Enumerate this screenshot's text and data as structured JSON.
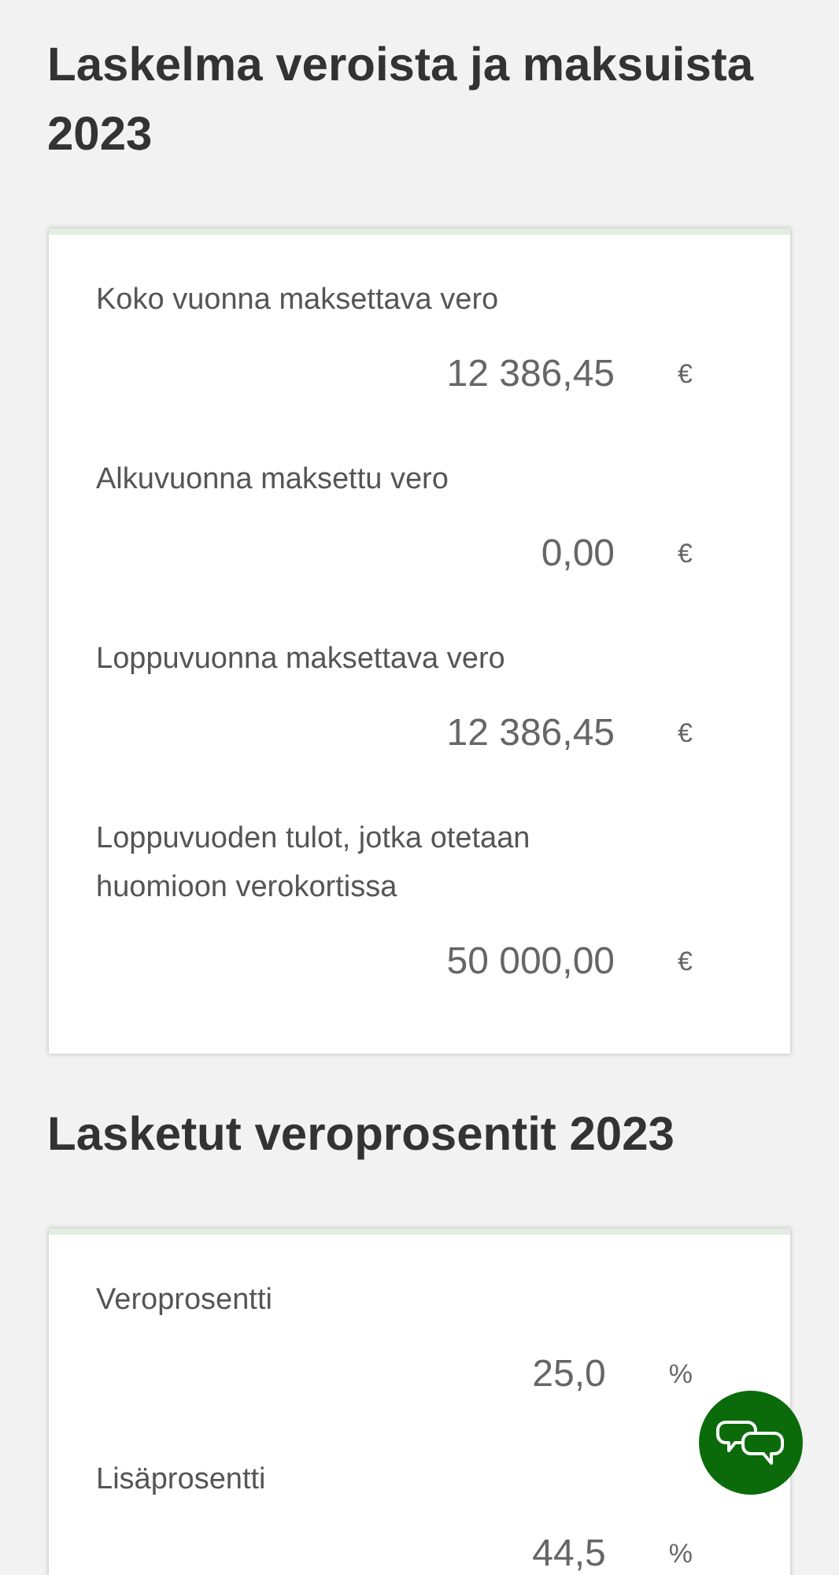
{
  "sections": [
    {
      "title": "Laskelma veroista ja maksuista 2023",
      "rows": [
        {
          "label": "Koko vuonna maksettava vero",
          "value": "12 386,45",
          "unit": "€"
        },
        {
          "label": "Alkuvuonna maksettu vero",
          "value": "0,00",
          "unit": "€"
        },
        {
          "label": "Loppuvuonna maksettava vero",
          "value": "12 386,45",
          "unit": "€"
        },
        {
          "label": "Loppuvuoden tulot, jotka otetaan huomioon verokortissa",
          "value": "50 000,00",
          "unit": "€"
        }
      ]
    },
    {
      "title": "Lasketut veroprosentit 2023",
      "rows": [
        {
          "label": "Veroprosentti",
          "value": "25,0",
          "unit": "%"
        },
        {
          "label": "Lisäprosentti",
          "value": "44,5",
          "unit": "%"
        }
      ]
    }
  ],
  "chat_button": {
    "kind": "chat"
  }
}
